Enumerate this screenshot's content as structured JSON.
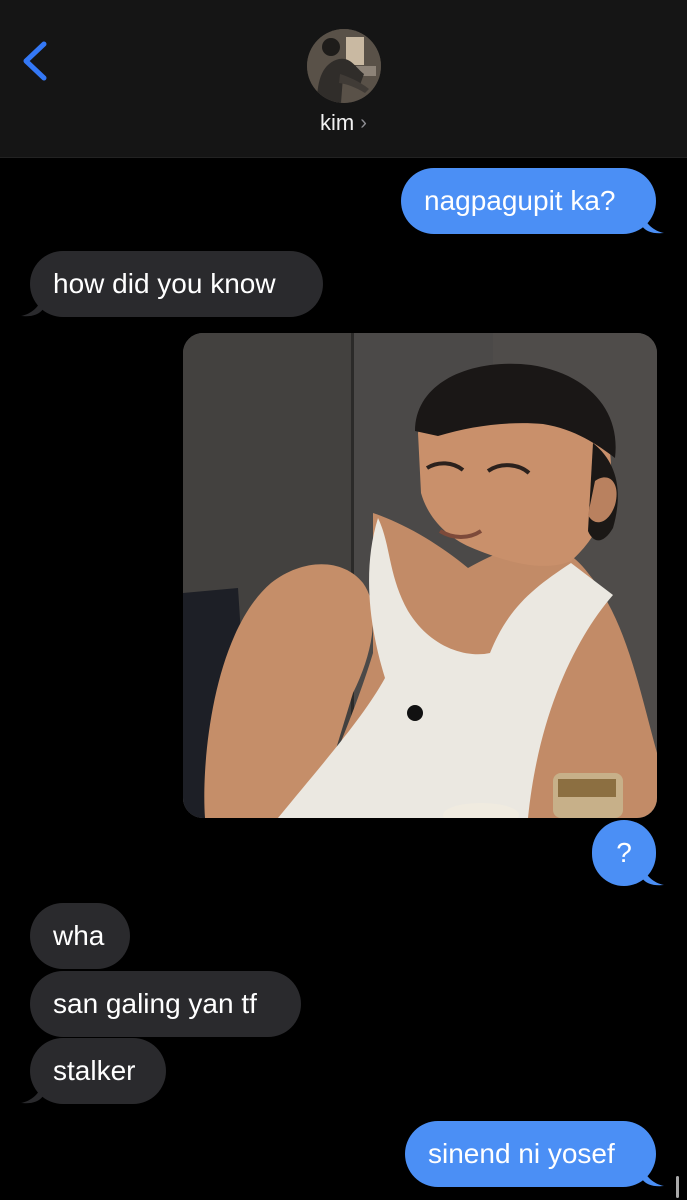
{
  "header": {
    "contact_name": "kim",
    "chevron": "›",
    "back_icon": "chevron-left-icon",
    "accent": "#3478f6"
  },
  "messages": [
    {
      "dir": "out",
      "text": "nagpagupit ka?"
    },
    {
      "dir": "in",
      "text": "how did you know"
    },
    {
      "dir": "out",
      "type": "photo"
    },
    {
      "dir": "out",
      "text": "?"
    },
    {
      "dir": "in",
      "text": "wha"
    },
    {
      "dir": "in",
      "text": "san galing yan tf"
    },
    {
      "dir": "in",
      "text": "stalker"
    },
    {
      "dir": "out",
      "text": "sinend ni yosef"
    }
  ],
  "colors": {
    "outgoing": "#4b8ff5",
    "incoming": "#2a2a2d",
    "background": "#000000",
    "header": "#151515"
  }
}
